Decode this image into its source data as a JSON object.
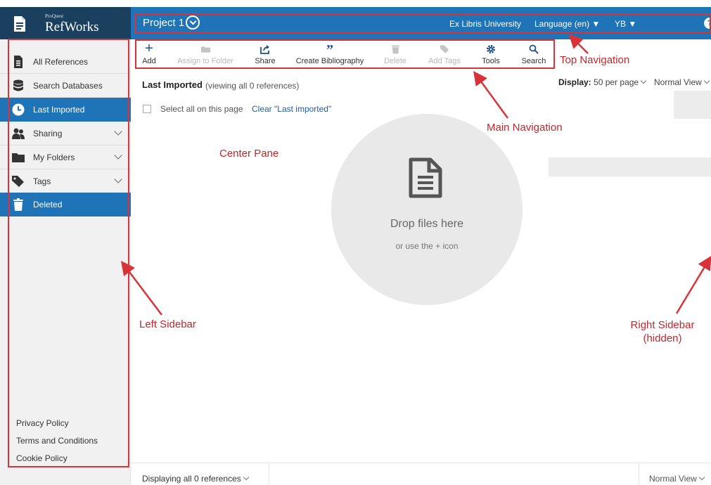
{
  "app": {
    "logo_small": "ProQuest",
    "logo_name": "RefWorks",
    "logo_icon": "document-icon"
  },
  "top_nav": {
    "project": "Project 1",
    "institution": "Ex Libris University",
    "language": "Language (en)",
    "user": "YB",
    "help": "?"
  },
  "sidebar": {
    "items": [
      {
        "label": "All References",
        "icon": "document-icon"
      },
      {
        "label": "Search Databases",
        "icon": "database-icon"
      },
      {
        "label": "Last Imported",
        "icon": "clock-icon"
      },
      {
        "label": "Sharing",
        "icon": "users-icon"
      },
      {
        "label": "My Folders",
        "icon": "folder-icon"
      },
      {
        "label": "Tags",
        "icon": "tag-icon"
      },
      {
        "label": "Deleted",
        "icon": "trash-icon"
      }
    ],
    "footer": [
      "Privacy Policy",
      "Terms and Conditions",
      "Cookie Policy"
    ]
  },
  "toolbar": {
    "items": [
      {
        "label": "Add",
        "icon": "plus-icon"
      },
      {
        "label": "Assign to Folder",
        "icon": "folder-icon"
      },
      {
        "label": "Share",
        "icon": "share-icon"
      },
      {
        "label": "Create Bibliography",
        "icon": "quote-icon"
      },
      {
        "label": "Delete",
        "icon": "trash-icon"
      },
      {
        "label": "Add Tags",
        "icon": "tag-icon"
      },
      {
        "label": "Tools",
        "icon": "gear-icon"
      },
      {
        "label": "Search",
        "icon": "search-icon"
      }
    ]
  },
  "center": {
    "heading": "Last Imported",
    "heading_sub": "(viewing all 0 references)",
    "select_all": "Select all on this page",
    "clear_link": "Clear \"Last imported\"",
    "display_label": "Display:",
    "per_page": "50 per page",
    "view": "Normal View",
    "drop_title": "Drop files here",
    "drop_sub": "or use the + icon"
  },
  "bottom": {
    "displaying": "Displaying all 0 references",
    "view": "Normal View"
  },
  "annotations": {
    "top_navigation": "Top Navigation",
    "main_navigation": "Main Navigation",
    "center_pane": "Center Pane",
    "left_sidebar": "Left Sidebar",
    "right_sidebar_line1": "Right Sidebar",
    "right_sidebar_line2": "(hidden)"
  },
  "colors": {
    "brand_blue": "#1f73b7",
    "logo_navy": "#1b3f5e",
    "annotation_red": "#d9333a"
  }
}
